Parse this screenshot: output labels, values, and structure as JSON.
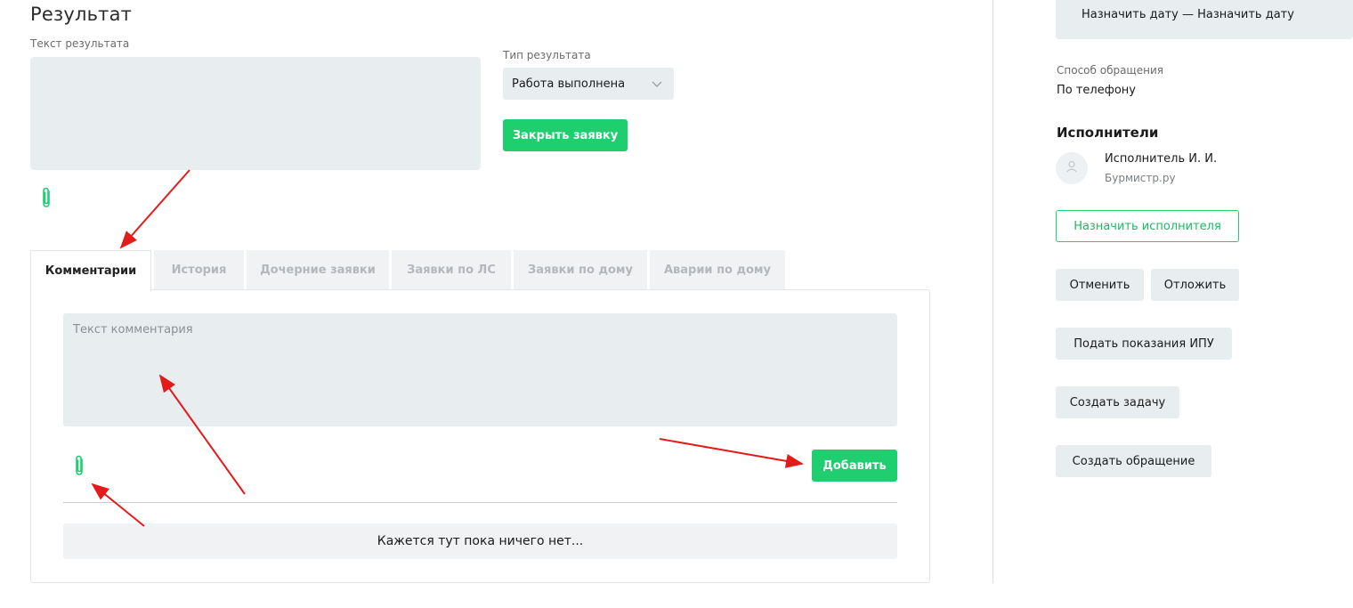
{
  "result": {
    "title": "Результат",
    "text_label": "Текст результата",
    "text_value": "",
    "type_label": "Тип результата",
    "type_value": "Работа выполнена",
    "close_button": "Закрыть заявку"
  },
  "tabs": [
    {
      "label": "Комментарии",
      "active": true
    },
    {
      "label": "История",
      "active": false
    },
    {
      "label": "Дочерние заявки",
      "active": false
    },
    {
      "label": "Заявки по ЛС",
      "active": false
    },
    {
      "label": "Заявки по дому",
      "active": false
    },
    {
      "label": "Аварии по дому",
      "active": false
    }
  ],
  "comments": {
    "placeholder": "Текст комментария",
    "add_button": "Добавить",
    "empty_text": "Кажется тут пока ничего нет..."
  },
  "sidebar": {
    "date_value": "Назначить дату — Назначить дату",
    "contact_method_label": "Способ обращения",
    "contact_method_value": "По телефону",
    "executors_title": "Исполнители",
    "executor_name": "Исполнитель И. И.",
    "executor_org": "Бурмистр.ру",
    "assign_button": "Назначить исполнителя",
    "cancel_button": "Отменить",
    "postpone_button": "Отложить",
    "meter_button": "Подать показания ИПУ",
    "task_button": "Создать задачу",
    "appeal_button": "Создать обращение"
  },
  "colors": {
    "accent": "#1fcf6f",
    "field_bg": "#e8eef0",
    "annotation_arrow": "#e31b1b"
  },
  "icons": [
    "paperclip-icon",
    "chevron-down-icon",
    "user-icon"
  ]
}
